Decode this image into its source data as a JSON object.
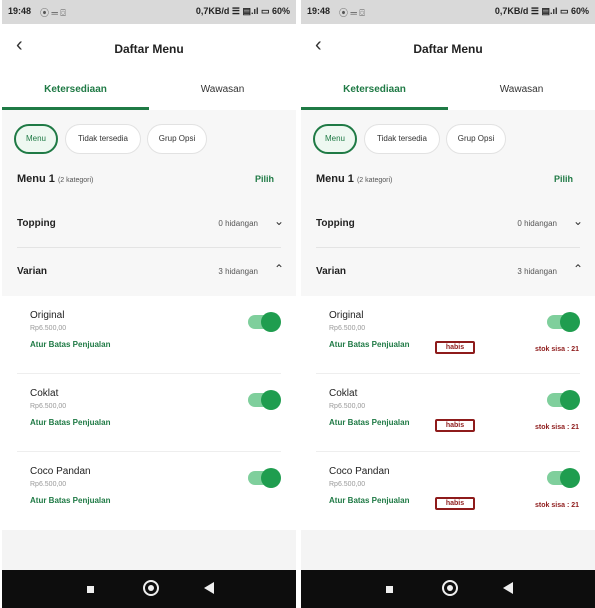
{
  "screens": [
    {
      "status": {
        "time": "19:48",
        "icons": "⦿ ═ ⌼",
        "network": "0,7KB/d ☰ ▤.ıl ▭ 60%"
      },
      "header": {
        "title": "Daftar Menu",
        "back_icon": "chevron-left"
      },
      "tabs": {
        "active": "Ketersediaan",
        "inactive": "Wawasan"
      },
      "chips": [
        "Menu",
        "Tidak tersedia",
        "Grup Opsi"
      ],
      "menu": {
        "title": "Menu 1",
        "count": "(2 kategori)",
        "action": "Pilih"
      },
      "groups": [
        {
          "name": "Topping",
          "count": "0 hidangan",
          "chevron": "⌄"
        },
        {
          "name": "Varian",
          "count": "3 hidangan",
          "chevron": "⌃"
        }
      ],
      "items": [
        {
          "name": "Original",
          "price": "Rp6.500,00",
          "link": "Atur Batas Penjualan"
        },
        {
          "name": "Coklat",
          "price": "Rp6.500,00",
          "link": "Atur Batas Penjualan"
        },
        {
          "name": "Coco Pandan",
          "price": "Rp6.500,00",
          "link": "Atur Batas Penjualan"
        }
      ]
    },
    {
      "status": {
        "time": "19:48",
        "icons": "⦿ ═ ⌼",
        "network": "0,7KB/d ☰ ▤.ıl ▭ 60%"
      },
      "header": {
        "title": "Daftar Menu",
        "back_icon": "chevron-left"
      },
      "tabs": {
        "active": "Ketersediaan",
        "inactive": "Wawasan"
      },
      "chips": [
        "Menu",
        "Tidak tersedia",
        "Grup Opsi"
      ],
      "menu": {
        "title": "Menu 1",
        "count": "(2 kategori)",
        "action": "Pilih"
      },
      "groups": [
        {
          "name": "Topping",
          "count": "0 hidangan",
          "chevron": "⌄"
        },
        {
          "name": "Varian",
          "count": "3 hidangan",
          "chevron": "⌃"
        }
      ],
      "items": [
        {
          "name": "Original",
          "price": "Rp6.500,00",
          "link": "Atur Batas Penjualan",
          "badge": "habis",
          "stock": "stok sisa : 21"
        },
        {
          "name": "Coklat",
          "price": "Rp6.500,00",
          "link": "Atur Batas Penjualan",
          "badge": "habis",
          "stock": "stok sisa : 21"
        },
        {
          "name": "Coco Pandan",
          "price": "Rp6.500,00",
          "link": "Atur Batas Penjualan",
          "badge": "habis",
          "stock": "stok sisa : 21"
        }
      ]
    }
  ],
  "colors": {
    "accent": "#1f7a45",
    "toggle_on": "#1f9d4f",
    "badge": "#8e1b1b"
  }
}
